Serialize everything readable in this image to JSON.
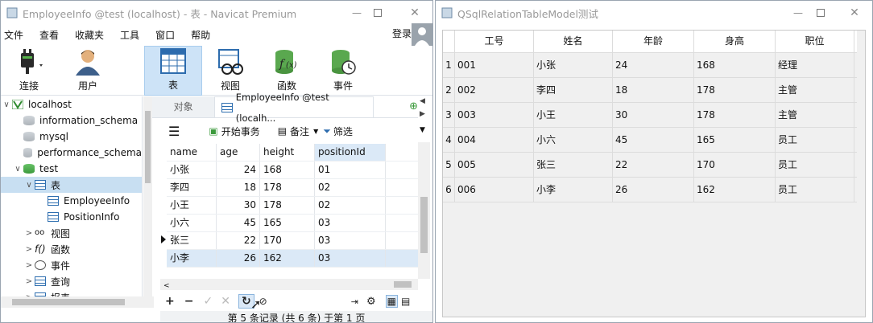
{
  "navicat": {
    "title": "EmployeeInfo @test (localhost) - 表 - Navicat Premium",
    "menu": [
      "文件",
      "查看",
      "收藏夹",
      "工具",
      "窗口",
      "帮助"
    ],
    "login": "登录",
    "tools": [
      {
        "label": "连接",
        "icon": "plug-icon"
      },
      {
        "label": "用户",
        "icon": "user-icon"
      },
      {
        "label": "表",
        "icon": "table-icon",
        "selected": true
      },
      {
        "label": "视图",
        "icon": "view-glasses-icon"
      },
      {
        "label": "函数",
        "icon": "function-icon"
      },
      {
        "label": "事件",
        "icon": "event-clock-icon"
      }
    ],
    "tree": [
      {
        "label": "localhost",
        "level": 0,
        "chev": "v",
        "icon": "server"
      },
      {
        "label": "information_schema",
        "level": 1,
        "icon": "db"
      },
      {
        "label": "mysql",
        "level": 1,
        "icon": "db"
      },
      {
        "label": "performance_schema",
        "level": 1,
        "icon": "db"
      },
      {
        "label": "test",
        "level": 1,
        "chev": "v",
        "icon": "dbg"
      },
      {
        "label": "表",
        "level": 2,
        "chev": "v",
        "icon": "tbl",
        "selected": true
      },
      {
        "label": "EmployeeInfo",
        "level": 3,
        "icon": "tbl"
      },
      {
        "label": "PositionInfo",
        "level": 3,
        "icon": "tbl"
      },
      {
        "label": "视图",
        "level": 2,
        "chev": ">",
        "icon": "oo"
      },
      {
        "label": "函数",
        "level": 2,
        "chev": ">",
        "icon": "fx"
      },
      {
        "label": "事件",
        "level": 2,
        "chev": ">",
        "icon": "clk"
      },
      {
        "label": "查询",
        "level": 2,
        "chev": ">",
        "icon": "qry"
      },
      {
        "label": "报表",
        "level": 2,
        "chev": ">",
        "icon": "rpt"
      }
    ],
    "tabs": {
      "objects": "对象",
      "active": "EmployeeInfo @test (localh..."
    },
    "subtool": {
      "begin": "开始事务",
      "note": "备注",
      "filter": "筛选"
    },
    "grid": {
      "columns": [
        "name",
        "age",
        "height",
        "positionId"
      ],
      "rows": [
        [
          "小张",
          "24",
          "168",
          "01"
        ],
        [
          "李四",
          "18",
          "178",
          "02"
        ],
        [
          "小王",
          "30",
          "178",
          "02"
        ],
        [
          "小六",
          "45",
          "165",
          "03"
        ],
        [
          "张三",
          "22",
          "170",
          "03"
        ],
        [
          "小李",
          "26",
          "162",
          "03"
        ]
      ]
    },
    "status": "第 5 条记录 (共 6 条) 于第 1 页"
  },
  "qt": {
    "title": "QSqlRelationTableModel测试",
    "columns": [
      "工号",
      "姓名",
      "年龄",
      "身高",
      "职位"
    ],
    "rows": [
      [
        "1",
        "001",
        "小张",
        "24",
        "168",
        "经理"
      ],
      [
        "2",
        "002",
        "李四",
        "18",
        "178",
        "主管"
      ],
      [
        "3",
        "003",
        "小王",
        "30",
        "178",
        "主管"
      ],
      [
        "4",
        "004",
        "小六",
        "45",
        "165",
        "员工"
      ],
      [
        "5",
        "005",
        "张三",
        "22",
        "170",
        "员工"
      ],
      [
        "6",
        "006",
        "小李",
        "26",
        "162",
        "员工"
      ]
    ]
  }
}
